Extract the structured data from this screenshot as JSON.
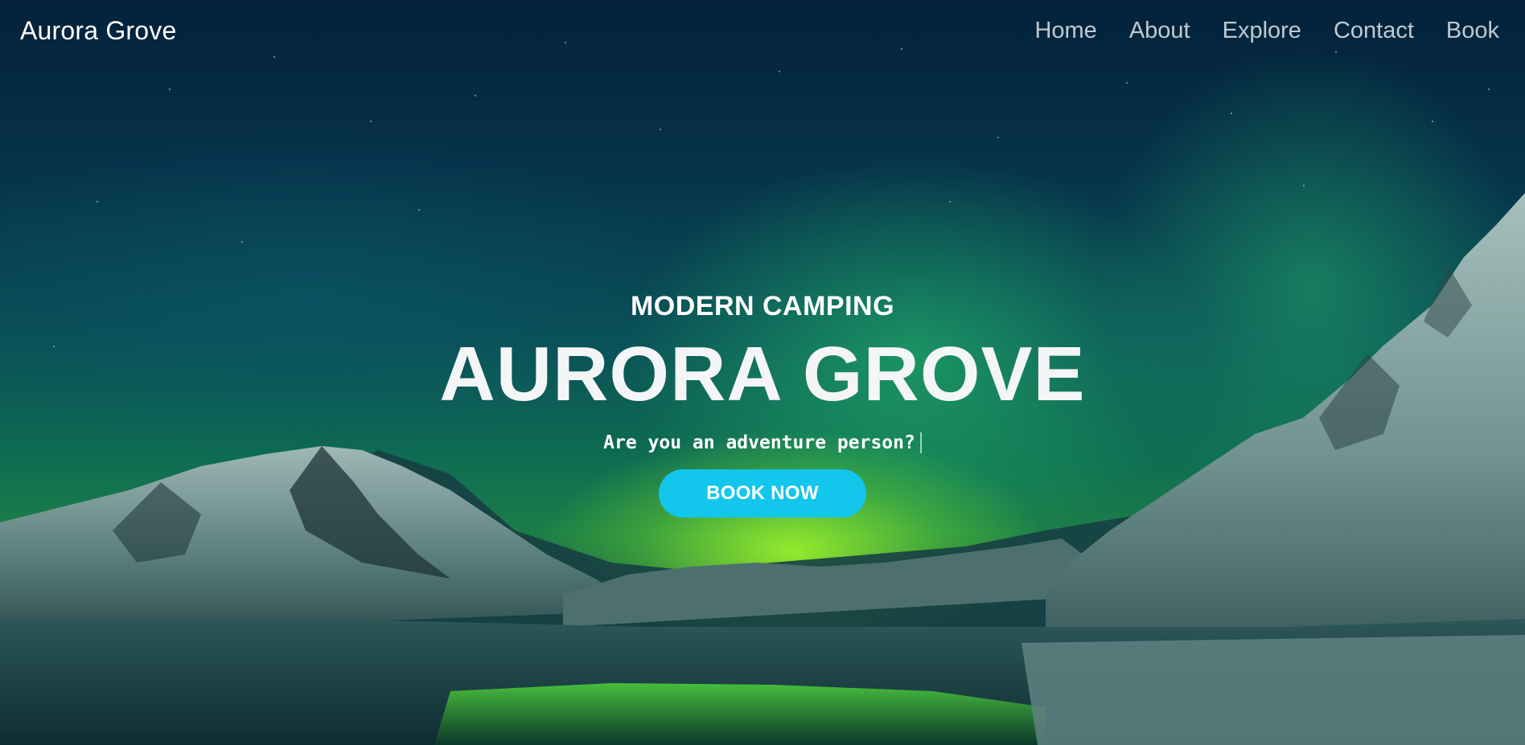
{
  "brand": {
    "name": "Aurora Grove"
  },
  "nav": {
    "items": [
      {
        "label": "Home"
      },
      {
        "label": "About"
      },
      {
        "label": "Explore"
      },
      {
        "label": "Contact"
      },
      {
        "label": "Book"
      }
    ]
  },
  "hero": {
    "eyebrow": "MODERN CAMPING",
    "title": "AURORA GROVE",
    "tagline": "Are you an adventure person?",
    "cta_label": "BOOK NOW",
    "background_image": "aurora borealis over snowy mountains"
  },
  "colors": {
    "accent": "#13c6ec",
    "text": "#ffffff",
    "aurora_green": "#7fe23a",
    "sky": "#04213a"
  }
}
